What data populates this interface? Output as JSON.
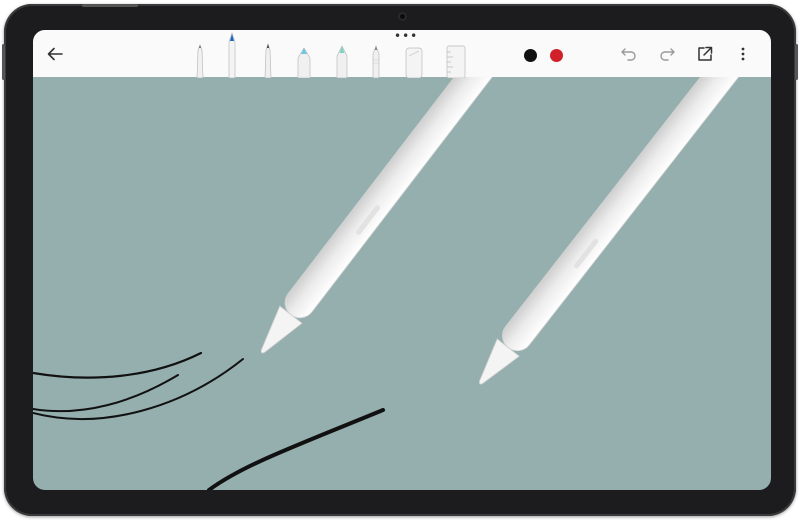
{
  "device": {
    "frame_color": "#1c1c1e",
    "screen_color": "#95afaf"
  },
  "toolbar": {
    "back_icon": "arrow-left-icon",
    "drag_handle_icon": "more-horizontal-icon",
    "tools": [
      {
        "name": "pen-tool",
        "icon": "pen-icon"
      },
      {
        "name": "fountain-pen-tool",
        "icon": "fountain-pen-icon",
        "accent": "#1565c0"
      },
      {
        "name": "ballpoint-tool",
        "icon": "ballpoint-icon"
      },
      {
        "name": "marker-tool",
        "icon": "marker-icon",
        "accent": "#6ec6e6"
      },
      {
        "name": "highlighter-tool",
        "icon": "highlighter-icon",
        "accent": "#7fd3c4"
      },
      {
        "name": "pencil-tool",
        "icon": "pencil-icon"
      },
      {
        "name": "eraser-tool",
        "icon": "eraser-icon"
      },
      {
        "name": "ruler-tool",
        "icon": "ruler-icon"
      }
    ],
    "colors": [
      "#111111",
      "#d0202a"
    ],
    "undo_icon": "undo-icon",
    "redo_icon": "redo-icon",
    "share_icon": "share-external-icon",
    "more_icon": "more-vertical-icon"
  },
  "canvas": {
    "ink_color": "#111111",
    "stylus_color": "#eeeeee"
  }
}
